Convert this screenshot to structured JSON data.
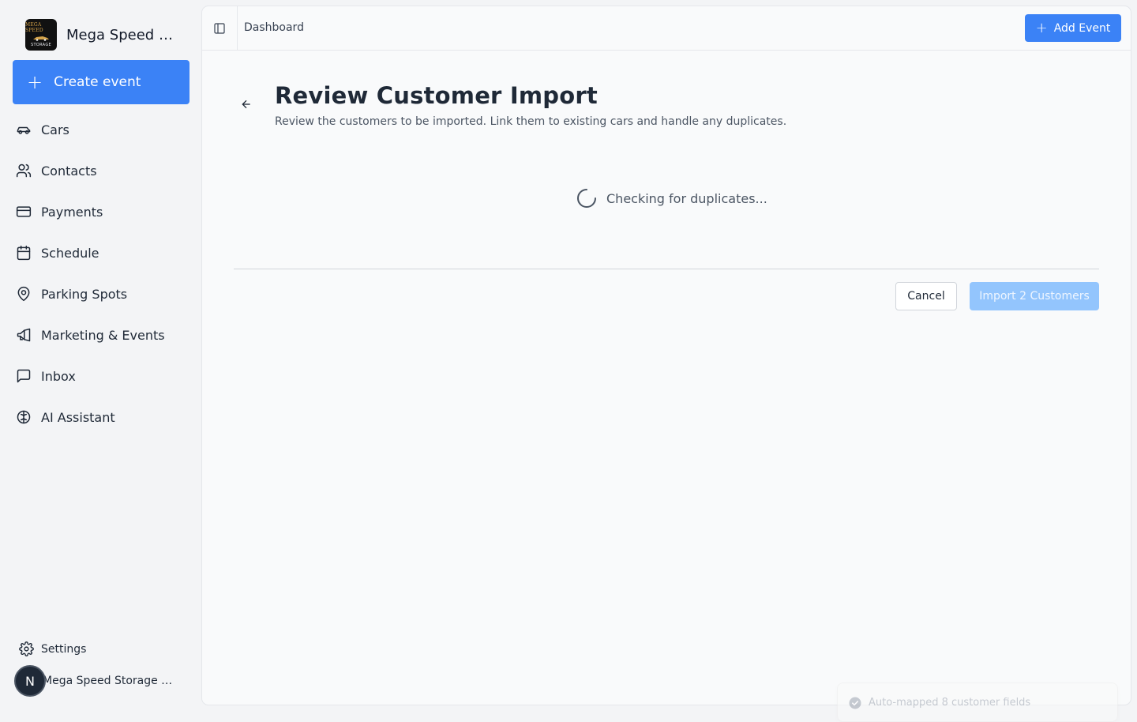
{
  "sidebar": {
    "brand": {
      "name": "Mega Speed St...",
      "logo_line1": "MEGA SPEED",
      "logo_line2": "STORAGE"
    },
    "create_label": "Create event",
    "items": [
      {
        "label": "Cars",
        "icon": "car-icon"
      },
      {
        "label": "Contacts",
        "icon": "users-icon"
      },
      {
        "label": "Payments",
        "icon": "credit-card-icon"
      },
      {
        "label": "Schedule",
        "icon": "calendar-icon"
      },
      {
        "label": "Parking Spots",
        "icon": "map-pin-icon"
      },
      {
        "label": "Marketing & Events",
        "icon": "megaphone-icon"
      },
      {
        "label": "Inbox",
        "icon": "message-square-icon"
      },
      {
        "label": "AI Assistant",
        "icon": "brain-icon"
      }
    ],
    "settings_label": "Settings",
    "account": {
      "initial": "N",
      "name": "Mega Speed Storage Ad..."
    }
  },
  "topbar": {
    "breadcrumb": "Dashboard",
    "add_event_label": "Add Event"
  },
  "page": {
    "title": "Review Customer Import",
    "subtitle": "Review the customers to be imported. Link them to existing cars and handle any duplicates.",
    "loading_text": "Checking for duplicates...",
    "cancel_label": "Cancel",
    "import_label": "Import 2 Customers"
  },
  "toast": {
    "text": "Auto-mapped 8 customer fields"
  },
  "colors": {
    "accent": "#3b82f6",
    "accent_disabled": "#93c5fd",
    "sidebar_bg": "#f3f4f6",
    "main_bg": "#f9fafb"
  }
}
